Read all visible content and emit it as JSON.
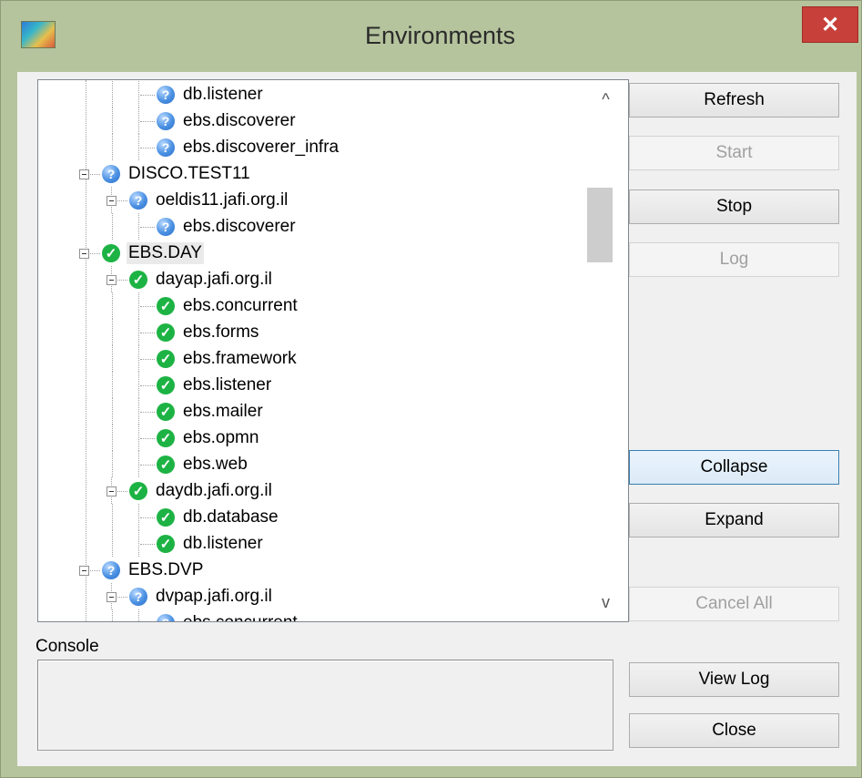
{
  "window": {
    "title": "Environments",
    "close_glyph": "✕"
  },
  "tree": {
    "nodes": [
      {
        "label": "db.listener",
        "status": "unknown",
        "level": 3
      },
      {
        "label": "ebs.discoverer",
        "status": "unknown",
        "level": 3
      },
      {
        "label": "ebs.discoverer_infra",
        "status": "unknown",
        "level": 3
      },
      {
        "label": "DISCO.TEST11",
        "status": "unknown",
        "level": 1
      },
      {
        "label": "oeldis11.jafi.org.il",
        "status": "unknown",
        "level": 2
      },
      {
        "label": "ebs.discoverer",
        "status": "unknown",
        "level": 3
      },
      {
        "label": "EBS.DAY",
        "status": "ok",
        "level": 1
      },
      {
        "label": "dayap.jafi.org.il",
        "status": "ok",
        "level": 2
      },
      {
        "label": "ebs.concurrent",
        "status": "ok",
        "level": 3
      },
      {
        "label": "ebs.forms",
        "status": "ok",
        "level": 3
      },
      {
        "label": "ebs.framework",
        "status": "ok",
        "level": 3
      },
      {
        "label": "ebs.listener",
        "status": "ok",
        "level": 3
      },
      {
        "label": "ebs.mailer",
        "status": "ok",
        "level": 3
      },
      {
        "label": "ebs.opmn",
        "status": "ok",
        "level": 3
      },
      {
        "label": "ebs.web",
        "status": "ok",
        "level": 3
      },
      {
        "label": "daydb.jafi.org.il",
        "status": "ok",
        "level": 2
      },
      {
        "label": "db.database",
        "status": "ok",
        "level": 3
      },
      {
        "label": "db.listener",
        "status": "ok",
        "level": 3
      },
      {
        "label": "EBS.DVP",
        "status": "unknown",
        "level": 1
      },
      {
        "label": "dvpap.jafi.org.il",
        "status": "unknown",
        "level": 2
      },
      {
        "label": "ebs.concurrent",
        "status": "unknown",
        "level": 3
      }
    ],
    "selected_label": "EBS.DAY",
    "scroll_up_glyph": "^",
    "scroll_down_glyph": "v"
  },
  "buttons": {
    "refresh": "Refresh",
    "start": "Start",
    "stop": "Stop",
    "log": "Log",
    "collapse": "Collapse",
    "expand": "Expand",
    "cancel_all": "Cancel All",
    "view_log": "View Log",
    "close": "Close"
  },
  "console": {
    "label": "Console",
    "value": ""
  },
  "colors": {
    "frame": "#b5c49d",
    "close": "#c7403a",
    "ok": "#1db344",
    "unknown": "#4a90e2"
  }
}
